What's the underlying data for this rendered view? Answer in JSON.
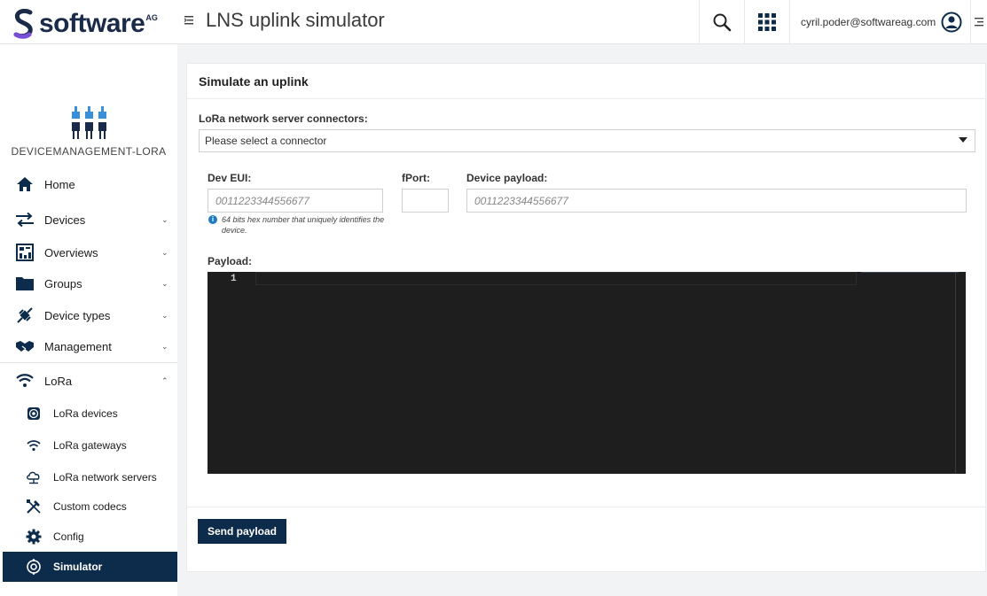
{
  "header": {
    "brand": "software",
    "brand_suffix": "AG",
    "app_title": "LNS uplink simulator",
    "user_email": "cyril.poder@softwareag.com",
    "icons": [
      "menu-collapse-icon",
      "search-icon",
      "app-switcher-icon",
      "user-icon",
      "right-drawer-icon"
    ]
  },
  "sidebar": {
    "app_name": "DEVICEMANAGEMENT-LORA",
    "items": [
      {
        "label": "Home",
        "icon": "home-icon"
      },
      {
        "label": "Devices",
        "icon": "devices-icon",
        "chevron": "⌄"
      },
      {
        "label": "Overviews",
        "icon": "overviews-icon",
        "chevron": "⌄"
      },
      {
        "label": "Groups",
        "icon": "folder-icon",
        "chevron": "⌄"
      },
      {
        "label": "Device types",
        "icon": "plug-icon",
        "chevron": "⌄"
      },
      {
        "label": "Management",
        "icon": "handshake-icon",
        "chevron": "⌄"
      },
      {
        "label": "LoRa",
        "icon": "wifi-icon",
        "chevron": "⌃"
      }
    ],
    "lora_items": [
      {
        "label": "LoRa devices",
        "icon": "target-icon"
      },
      {
        "label": "LoRa gateways",
        "icon": "wifi-icon"
      },
      {
        "label": "LoRa network servers",
        "icon": "cloud-icon"
      },
      {
        "label": "Custom codecs",
        "icon": "tools-icon"
      },
      {
        "label": "Config",
        "icon": "gear-icon"
      },
      {
        "label": "Simulator",
        "icon": "simulator-icon",
        "active": true
      }
    ]
  },
  "main": {
    "title": "Simulate an uplink",
    "connector_label": "LoRa network server connectors:",
    "connector_value": "Please select a connector",
    "dev_eui_label": "Dev EUI:",
    "dev_eui_placeholder": "0011223344556677",
    "dev_eui_help": "64 bits hex number that uniquely identifies the device.",
    "fport_label": "fPort:",
    "fport_value": "",
    "device_payload_label": "Device payload:",
    "device_payload_placeholder": "0011223344556677",
    "payload_label": "Payload:",
    "editor_line_number": "1",
    "send_button": "Send payload"
  },
  "colors": {
    "accent_dark": "#0d2b4a",
    "brand_purple": "#7a4fd8",
    "editor_bg": "#1e1e1e",
    "info_blue": "#1f7cc4"
  }
}
